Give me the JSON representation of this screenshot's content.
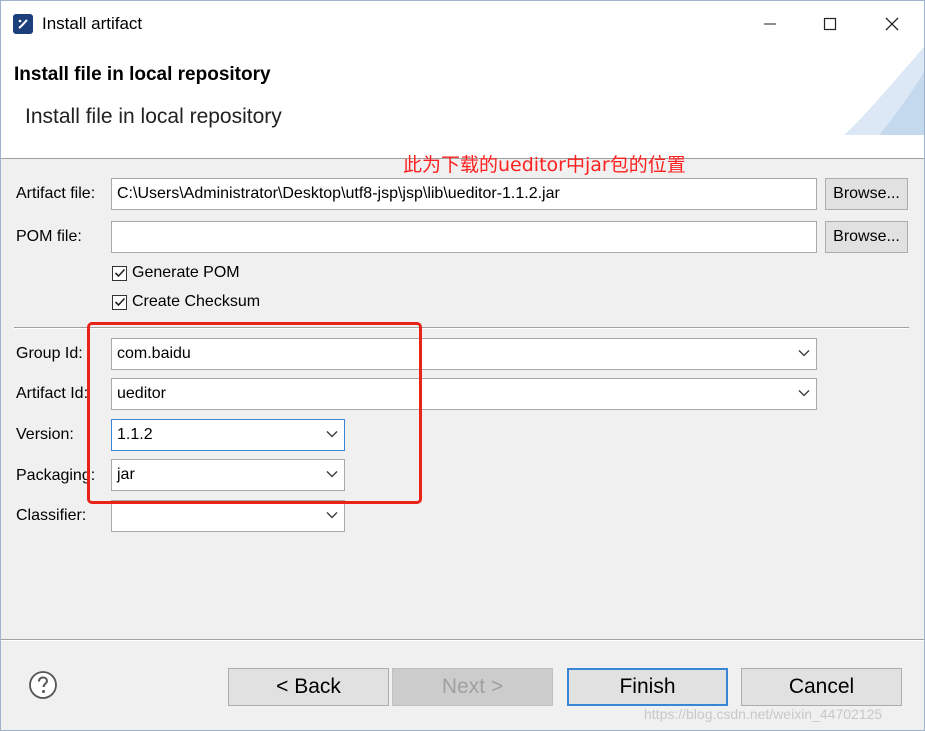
{
  "window": {
    "title": "Install artifact",
    "minimize_label": "—",
    "maximize_label": "☐",
    "close_label": "✕"
  },
  "header": {
    "title": "Install file in local repository",
    "subtitle": "Install file in local repository"
  },
  "annotation": "此为下载的ueditor中jar包的位置",
  "form": {
    "artifact_file": {
      "label": "Artifact file:",
      "value": "C:\\Users\\Administrator\\Desktop\\utf8-jsp\\jsp\\lib\\ueditor-1.1.2.jar",
      "browse_label": "Browse..."
    },
    "pom_file": {
      "label": "POM file:",
      "value": "",
      "browse_label": "Browse..."
    },
    "generate_pom": {
      "label": "Generate POM",
      "checked": true
    },
    "create_checksum": {
      "label": "Create Checksum",
      "checked": true
    },
    "group_id": {
      "label": "Group Id:",
      "value": "com.baidu"
    },
    "artifact_id": {
      "label": "Artifact Id:",
      "value": "ueditor"
    },
    "version": {
      "label": "Version:",
      "value": "1.1.2"
    },
    "packaging": {
      "label": "Packaging:",
      "value": "jar"
    },
    "classifier": {
      "label": "Classifier:",
      "value": ""
    }
  },
  "footer": {
    "back_label": "< Back",
    "next_label": "Next >",
    "finish_label": "Finish",
    "cancel_label": "Cancel"
  },
  "watermark": "https://blog.csdn.net/weixin_44702125",
  "colors": {
    "highlight_box": "#e8231a",
    "annotation_text": "#ff2020",
    "focus_border": "#3a86d6"
  }
}
